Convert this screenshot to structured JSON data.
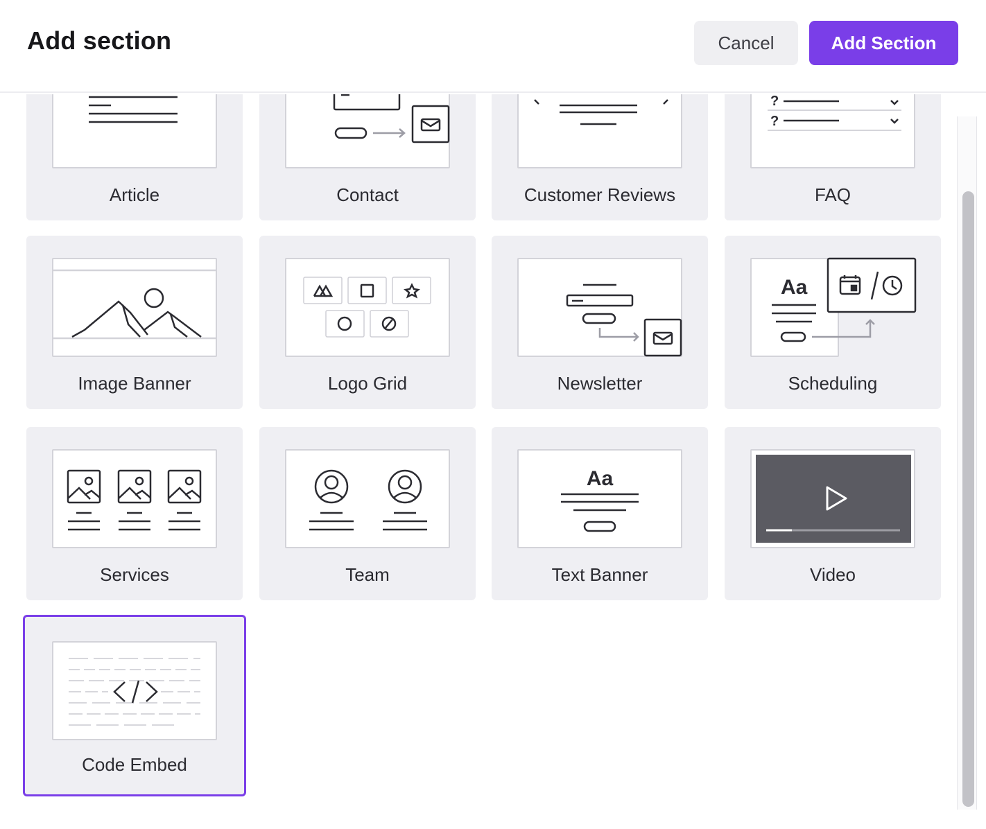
{
  "header": {
    "title": "Add section",
    "cancel_label": "Cancel",
    "add_label": "Add Section"
  },
  "sections": [
    {
      "label": "Article"
    },
    {
      "label": "Contact"
    },
    {
      "label": "Customer Reviews"
    },
    {
      "label": "FAQ"
    },
    {
      "label": "Image Banner"
    },
    {
      "label": "Logo Grid"
    },
    {
      "label": "Newsletter"
    },
    {
      "label": "Scheduling",
      "icon_text": "Aa"
    },
    {
      "label": "Services"
    },
    {
      "label": "Team"
    },
    {
      "label": "Text Banner",
      "icon_text": "Aa"
    },
    {
      "label": "Video"
    },
    {
      "label": "Code Embed",
      "selected": true
    }
  ],
  "faq_marks": [
    "?",
    "?"
  ],
  "colors": {
    "accent": "#7a3ee8",
    "card_bg": "#efeff3",
    "video_bg": "#5b5b62"
  }
}
